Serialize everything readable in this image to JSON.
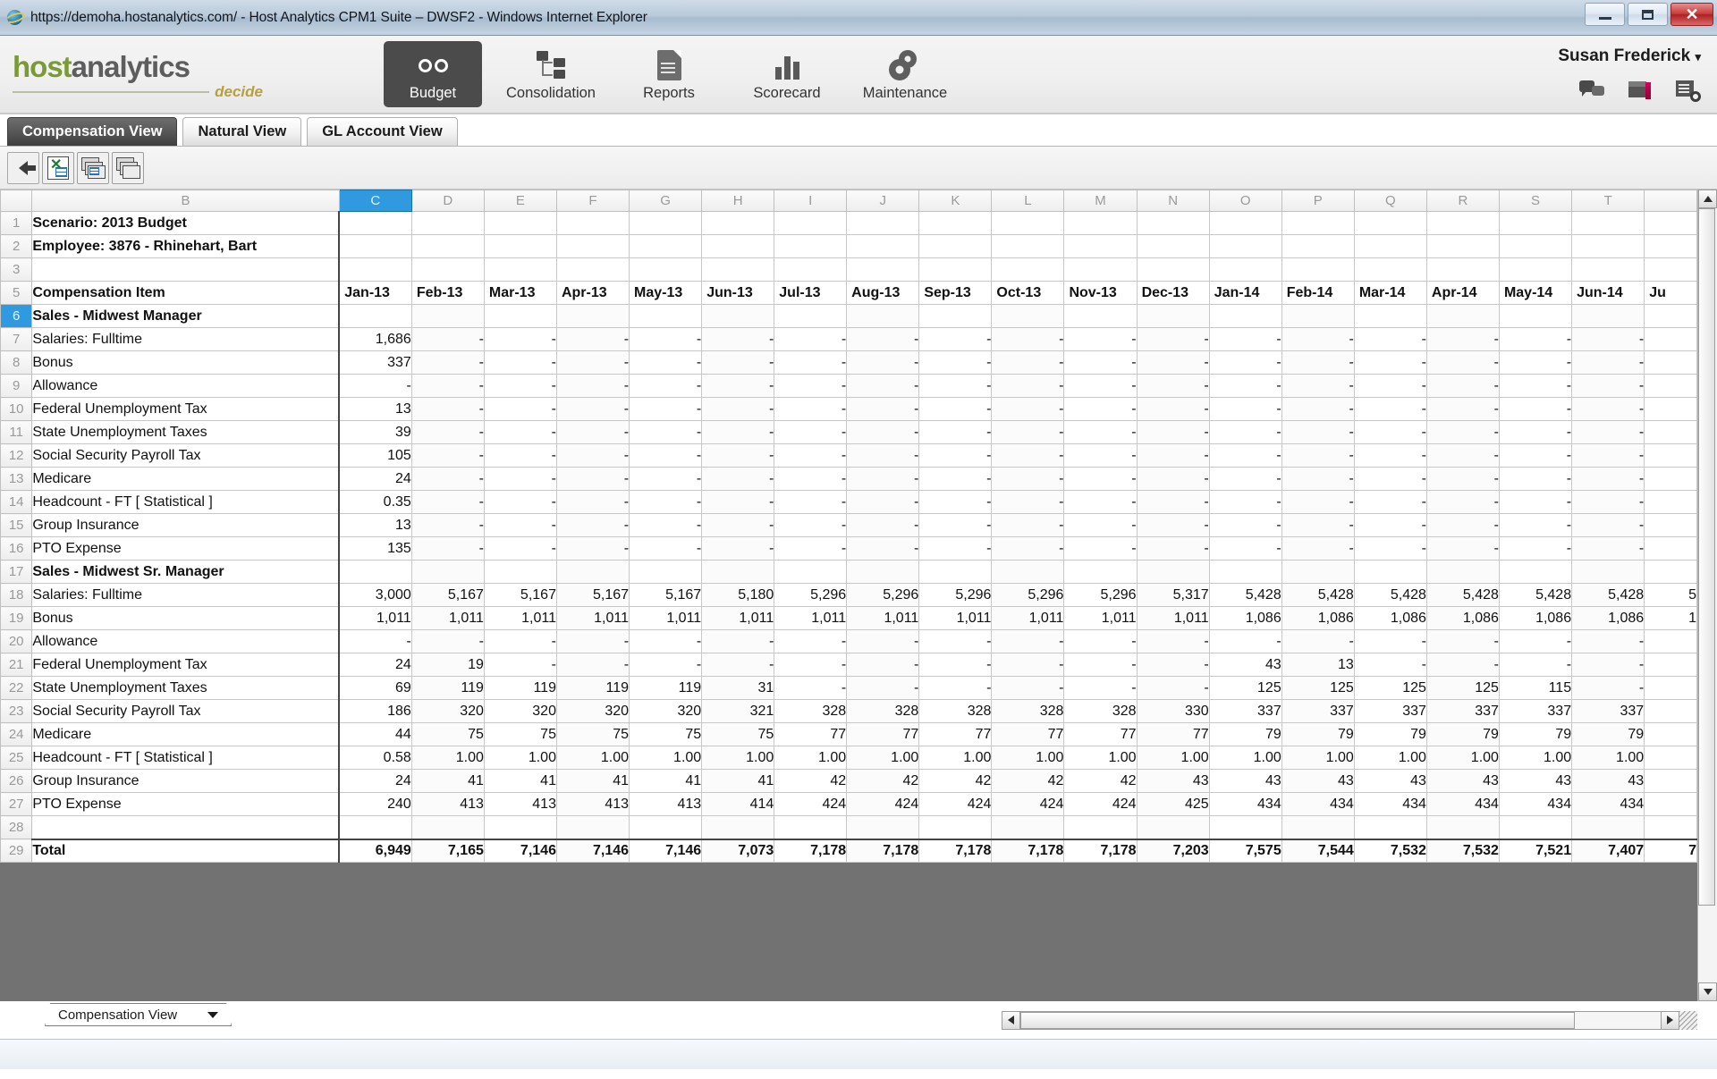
{
  "window": {
    "title": "https://demoha.hostanalytics.com/ - Host Analytics CPM1 Suite – DWSF2 - Windows Internet Explorer",
    "minimize_label": "Minimize",
    "maximize_label": "Maximize",
    "close_label": "✕"
  },
  "brand": {
    "part1": "host",
    "part2": "analytics",
    "tagline": "decide"
  },
  "nav": {
    "items": [
      {
        "label": "Budget",
        "icon": "binoculars-icon",
        "active": true
      },
      {
        "label": "Consolidation",
        "icon": "consolidation-icon",
        "active": false
      },
      {
        "label": "Reports",
        "icon": "document-icon",
        "active": false
      },
      {
        "label": "Scorecard",
        "icon": "bar-chart-icon",
        "active": false
      },
      {
        "label": "Maintenance",
        "icon": "gears-icon",
        "active": false
      }
    ]
  },
  "user": {
    "name": "Susan Frederick",
    "caret": "▾",
    "icons": [
      "chat-icon",
      "package-alert-icon",
      "document-search-icon"
    ]
  },
  "view_tabs": [
    {
      "label": "Compensation View",
      "active": true
    },
    {
      "label": "Natural View",
      "active": false
    },
    {
      "label": "GL Account View",
      "active": false
    }
  ],
  "toolbar": {
    "buttons": [
      {
        "name": "back-button",
        "icon": "left-arrow-icon"
      },
      {
        "name": "export-excel-button",
        "icon": "excel-sheet-icon"
      },
      {
        "name": "print-button",
        "icon": "print-stack-icon"
      },
      {
        "name": "copy-stack-button",
        "icon": "stack-icon"
      }
    ]
  },
  "spreadsheet": {
    "selected_column": "C",
    "selected_row": "6",
    "column_letters": [
      "B",
      "C",
      "D",
      "E",
      "F",
      "G",
      "H",
      "I",
      "J",
      "K",
      "L",
      "M",
      "N",
      "O",
      "P",
      "Q",
      "R",
      "S",
      "T"
    ],
    "row_numbers": [
      "1",
      "2",
      "3",
      "5",
      "6",
      "7",
      "8",
      "9",
      "10",
      "11",
      "12",
      "13",
      "14",
      "15",
      "16",
      "17",
      "18",
      "19",
      "20",
      "21",
      "22",
      "23",
      "24",
      "25",
      "26",
      "27",
      "28",
      "29"
    ],
    "period_headers": [
      "Jan-13",
      "Feb-13",
      "Mar-13",
      "Apr-13",
      "May-13",
      "Jun-13",
      "Jul-13",
      "Aug-13",
      "Sep-13",
      "Oct-13",
      "Nov-13",
      "Dec-13",
      "Jan-14",
      "Feb-14",
      "Mar-14",
      "Apr-14",
      "May-14",
      "Jun-14",
      "Ju"
    ],
    "title_rows": [
      {
        "row": "1",
        "text": "Scenario: 2013 Budget"
      },
      {
        "row": "2",
        "text": "Employee: 3876 - Rhinehart, Bart"
      },
      {
        "row": "3",
        "text": ""
      }
    ],
    "header_label": "Compensation Item",
    "rows": [
      {
        "row": "6",
        "label": "Sales - Midwest Manager",
        "indent": 1,
        "kind": "group",
        "values": [
          "",
          "",
          "",
          "",
          "",
          "",
          "",
          "",
          "",
          "",
          "",
          "",
          "",
          "",
          "",
          "",
          "",
          "",
          ""
        ]
      },
      {
        "row": "7",
        "label": "Salaries: Fulltime",
        "indent": 2,
        "kind": "data",
        "values": [
          "1,686",
          "-",
          "-",
          "-",
          "-",
          "-",
          "-",
          "-",
          "-",
          "-",
          "-",
          "-",
          "-",
          "-",
          "-",
          "-",
          "-",
          "-",
          ""
        ]
      },
      {
        "row": "8",
        "label": "Bonus",
        "indent": 2,
        "kind": "data",
        "values": [
          "337",
          "-",
          "-",
          "-",
          "-",
          "-",
          "-",
          "-",
          "-",
          "-",
          "-",
          "-",
          "-",
          "-",
          "-",
          "-",
          "-",
          "-",
          ""
        ]
      },
      {
        "row": "9",
        "label": "Allowance",
        "indent": 2,
        "kind": "data",
        "values": [
          "-",
          "-",
          "-",
          "-",
          "-",
          "-",
          "-",
          "-",
          "-",
          "-",
          "-",
          "-",
          "-",
          "-",
          "-",
          "-",
          "-",
          "-",
          ""
        ]
      },
      {
        "row": "10",
        "label": "Federal Unemployment Tax",
        "indent": 2,
        "kind": "data",
        "values": [
          "13",
          "-",
          "-",
          "-",
          "-",
          "-",
          "-",
          "-",
          "-",
          "-",
          "-",
          "-",
          "-",
          "-",
          "-",
          "-",
          "-",
          "-",
          ""
        ]
      },
      {
        "row": "11",
        "label": "State Unemployment Taxes",
        "indent": 2,
        "kind": "data",
        "values": [
          "39",
          "-",
          "-",
          "-",
          "-",
          "-",
          "-",
          "-",
          "-",
          "-",
          "-",
          "-",
          "-",
          "-",
          "-",
          "-",
          "-",
          "-",
          ""
        ]
      },
      {
        "row": "12",
        "label": "Social Security Payroll Tax",
        "indent": 2,
        "kind": "data",
        "values": [
          "105",
          "-",
          "-",
          "-",
          "-",
          "-",
          "-",
          "-",
          "-",
          "-",
          "-",
          "-",
          "-",
          "-",
          "-",
          "-",
          "-",
          "-",
          ""
        ]
      },
      {
        "row": "13",
        "label": "Medicare",
        "indent": 2,
        "kind": "data",
        "values": [
          "24",
          "-",
          "-",
          "-",
          "-",
          "-",
          "-",
          "-",
          "-",
          "-",
          "-",
          "-",
          "-",
          "-",
          "-",
          "-",
          "-",
          "-",
          ""
        ]
      },
      {
        "row": "14",
        "label": "Headcount - FT  [ Statistical ]",
        "indent": 2,
        "kind": "data",
        "values": [
          "0.35",
          "-",
          "-",
          "-",
          "-",
          "-",
          "-",
          "-",
          "-",
          "-",
          "-",
          "-",
          "-",
          "-",
          "-",
          "-",
          "-",
          "-",
          ""
        ]
      },
      {
        "row": "15",
        "label": "Group Insurance",
        "indent": 2,
        "kind": "data",
        "values": [
          "13",
          "-",
          "-",
          "-",
          "-",
          "-",
          "-",
          "-",
          "-",
          "-",
          "-",
          "-",
          "-",
          "-",
          "-",
          "-",
          "-",
          "-",
          ""
        ]
      },
      {
        "row": "16",
        "label": "PTO Expense",
        "indent": 2,
        "kind": "data",
        "values": [
          "135",
          "-",
          "-",
          "-",
          "-",
          "-",
          "-",
          "-",
          "-",
          "-",
          "-",
          "-",
          "-",
          "-",
          "-",
          "-",
          "-",
          "-",
          ""
        ]
      },
      {
        "row": "17",
        "label": "Sales - Midwest Sr. Manager",
        "indent": 1,
        "kind": "group",
        "values": [
          "",
          "",
          "",
          "",
          "",
          "",
          "",
          "",
          "",
          "",
          "",
          "",
          "",
          "",
          "",
          "",
          "",
          "",
          ""
        ]
      },
      {
        "row": "18",
        "label": "Salaries: Fulltime",
        "indent": 2,
        "kind": "data",
        "values": [
          "3,000",
          "5,167",
          "5,167",
          "5,167",
          "5,167",
          "5,180",
          "5,296",
          "5,296",
          "5,296",
          "5,296",
          "5,296",
          "5,317",
          "5,428",
          "5,428",
          "5,428",
          "5,428",
          "5,428",
          "5,428",
          "5"
        ]
      },
      {
        "row": "19",
        "label": "Bonus",
        "indent": 2,
        "kind": "data",
        "values": [
          "1,011",
          "1,011",
          "1,011",
          "1,011",
          "1,011",
          "1,011",
          "1,011",
          "1,011",
          "1,011",
          "1,011",
          "1,011",
          "1,011",
          "1,086",
          "1,086",
          "1,086",
          "1,086",
          "1,086",
          "1,086",
          "1"
        ]
      },
      {
        "row": "20",
        "label": "Allowance",
        "indent": 2,
        "kind": "data",
        "values": [
          "-",
          "-",
          "-",
          "-",
          "-",
          "-",
          "-",
          "-",
          "-",
          "-",
          "-",
          "-",
          "-",
          "-",
          "-",
          "-",
          "-",
          "-",
          ""
        ]
      },
      {
        "row": "21",
        "label": "Federal Unemployment Tax",
        "indent": 2,
        "kind": "data",
        "values": [
          "24",
          "19",
          "-",
          "-",
          "-",
          "-",
          "-",
          "-",
          "-",
          "-",
          "-",
          "-",
          "43",
          "13",
          "-",
          "-",
          "-",
          "-",
          ""
        ]
      },
      {
        "row": "22",
        "label": "State Unemployment Taxes",
        "indent": 2,
        "kind": "data",
        "values": [
          "69",
          "119",
          "119",
          "119",
          "119",
          "31",
          "-",
          "-",
          "-",
          "-",
          "-",
          "-",
          "125",
          "125",
          "125",
          "125",
          "115",
          "-",
          ""
        ]
      },
      {
        "row": "23",
        "label": "Social Security Payroll Tax",
        "indent": 2,
        "kind": "data",
        "values": [
          "186",
          "320",
          "320",
          "320",
          "320",
          "321",
          "328",
          "328",
          "328",
          "328",
          "328",
          "330",
          "337",
          "337",
          "337",
          "337",
          "337",
          "337",
          ""
        ]
      },
      {
        "row": "24",
        "label": "Medicare",
        "indent": 2,
        "kind": "data",
        "values": [
          "44",
          "75",
          "75",
          "75",
          "75",
          "75",
          "77",
          "77",
          "77",
          "77",
          "77",
          "77",
          "79",
          "79",
          "79",
          "79",
          "79",
          "79",
          ""
        ]
      },
      {
        "row": "25",
        "label": "Headcount - FT  [ Statistical ]",
        "indent": 2,
        "kind": "data",
        "values": [
          "0.58",
          "1.00",
          "1.00",
          "1.00",
          "1.00",
          "1.00",
          "1.00",
          "1.00",
          "1.00",
          "1.00",
          "1.00",
          "1.00",
          "1.00",
          "1.00",
          "1.00",
          "1.00",
          "1.00",
          "1.00",
          ""
        ]
      },
      {
        "row": "26",
        "label": "Group Insurance",
        "indent": 2,
        "kind": "data",
        "values": [
          "24",
          "41",
          "41",
          "41",
          "41",
          "41",
          "42",
          "42",
          "42",
          "42",
          "42",
          "43",
          "43",
          "43",
          "43",
          "43",
          "43",
          "43",
          ""
        ]
      },
      {
        "row": "27",
        "label": "PTO Expense",
        "indent": 2,
        "kind": "data",
        "values": [
          "240",
          "413",
          "413",
          "413",
          "413",
          "414",
          "424",
          "424",
          "424",
          "424",
          "424",
          "425",
          "434",
          "434",
          "434",
          "434",
          "434",
          "434",
          ""
        ]
      },
      {
        "row": "28",
        "label": "",
        "indent": 0,
        "kind": "blank",
        "values": [
          "",
          "",
          "",
          "",
          "",
          "",
          "",
          "",
          "",
          "",
          "",
          "",
          "",
          "",
          "",
          "",
          "",
          "",
          ""
        ]
      },
      {
        "row": "29",
        "label": "Total",
        "indent": 1,
        "kind": "total",
        "values": [
          "6,949",
          "7,165",
          "7,146",
          "7,146",
          "7,146",
          "7,073",
          "7,178",
          "7,178",
          "7,178",
          "7,178",
          "7,178",
          "7,203",
          "7,575",
          "7,544",
          "7,532",
          "7,532",
          "7,521",
          "7,407",
          "7"
        ]
      }
    ]
  },
  "bottom": {
    "sheet_tab": "Compensation View",
    "sheet_tab_caret": "▼"
  }
}
